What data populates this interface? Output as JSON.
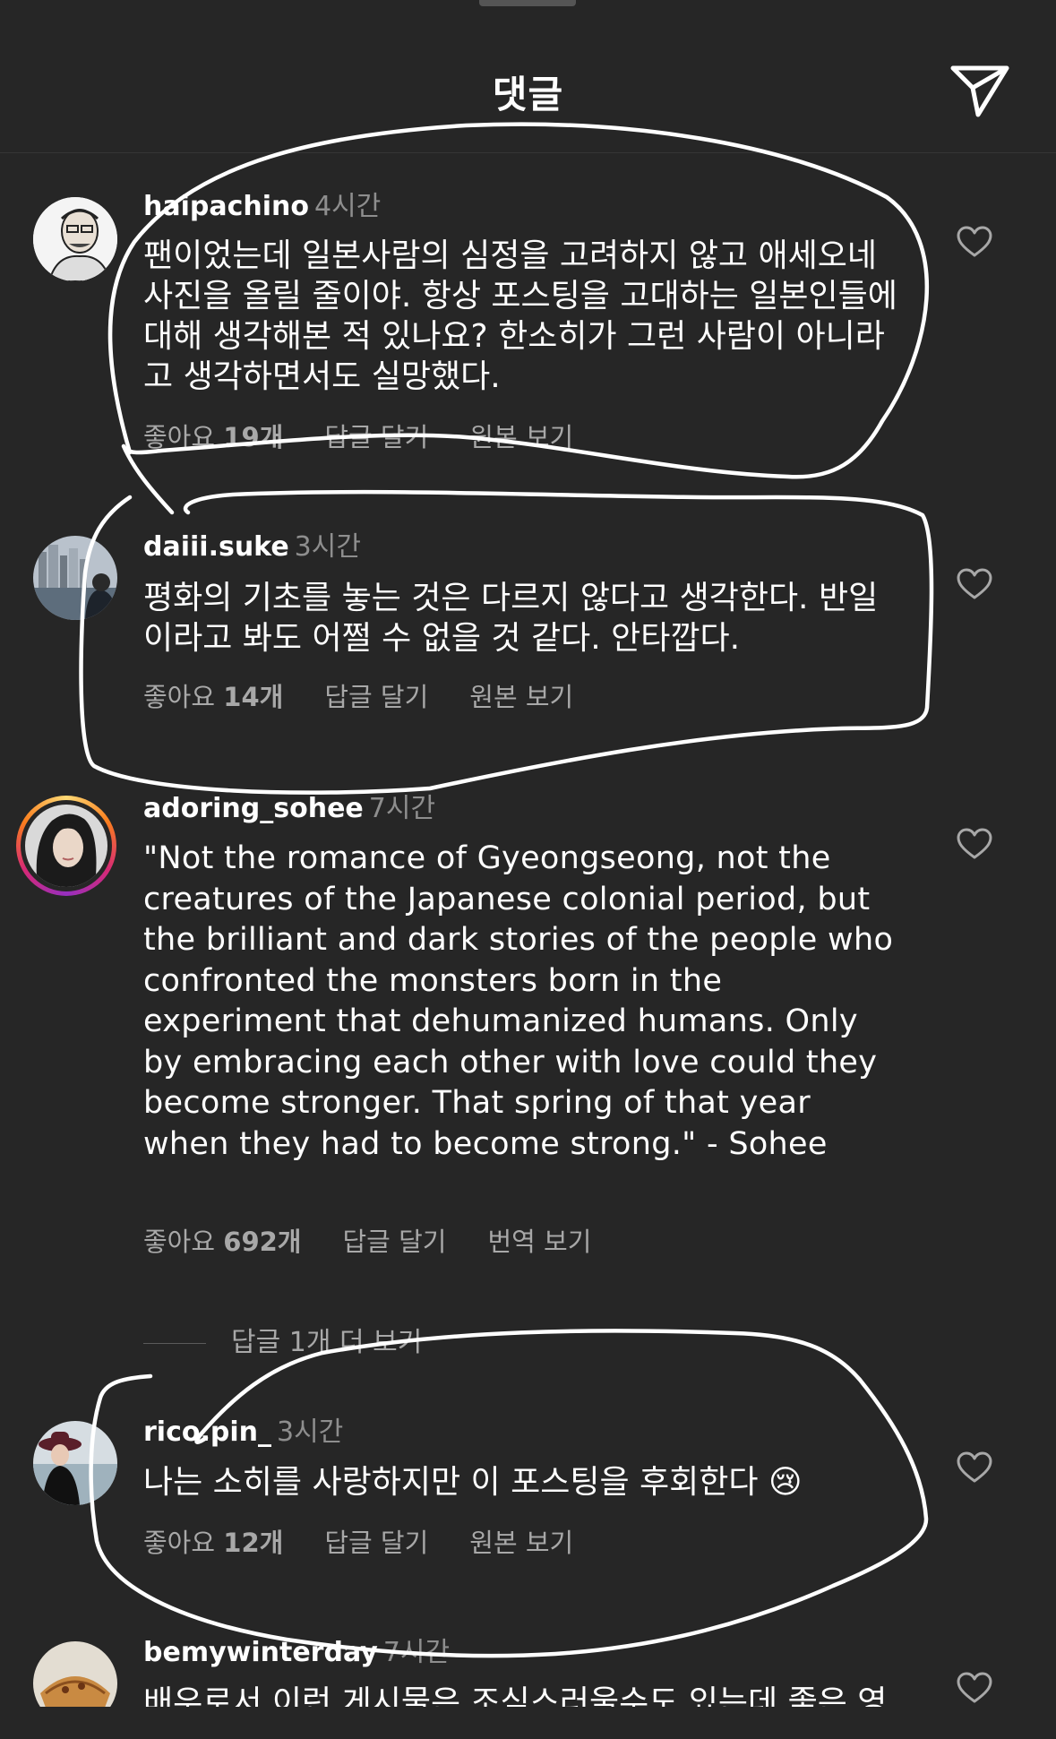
{
  "header": {
    "title": "댓글",
    "share_icon": "paper-plane-icon"
  },
  "comments": [
    {
      "username": "haipachino",
      "time": "4시간",
      "text": "팬이었는데 일본사람의 심정을 고려하지 않고 애세오네 사진을 올릴 줄이야. 항상 포스팅을 고대하는 일본인들에 대해 생각해본 적 있나요? 한소히가 그런 사람이 아니라고 생각하면서도 실망했다.",
      "likes_prefix": "좋아요 ",
      "likes_count": "19개",
      "reply_label": "답글 달기",
      "secondary_label": "원본 보기"
    },
    {
      "username": "daiii.suke",
      "time": "3시간",
      "text": "평화의 기초를 놓는 것은 다르지 않다고 생각한다. 반일이라고 봐도 어쩔 수 없을 것 같다. 안타깝다.",
      "likes_prefix": "좋아요 ",
      "likes_count": "14개",
      "reply_label": "답글 달기",
      "secondary_label": "원본 보기"
    },
    {
      "username": "adoring_sohee",
      "time": "7시간",
      "text": "\"Not the romance of Gyeongseong, not the creatures of the Japanese colonial period, but the brilliant and dark stories of the people who confronted the monsters born in the experiment that dehumanized humans. Only by embracing each other with love could they become stronger. That spring of that year when they had to become strong.\" - Sohee",
      "likes_prefix": "좋아요 ",
      "likes_count": "692개",
      "reply_label": "답글 달기",
      "secondary_label": "번역 보기",
      "view_replies_label": "답글 1개 더 보기"
    },
    {
      "username": "rico.pin_",
      "time": "3시간",
      "text": "나는 소히를 사랑하지만 이 포스팅을 후회한다 😢",
      "likes_prefix": "좋아요 ",
      "likes_count": "12개",
      "reply_label": "답글 달기",
      "secondary_label": "원본 보기"
    },
    {
      "username": "bemywinterday",
      "time": "7시간",
      "text": "배우로서 이런 게시물은 조심스러울수도 있는데 좋은 영"
    }
  ],
  "colors": {
    "background": "#262626",
    "secondary_text": "#a8a8a8",
    "time_text": "#8e8e8e",
    "scribble": "#ffffff"
  }
}
